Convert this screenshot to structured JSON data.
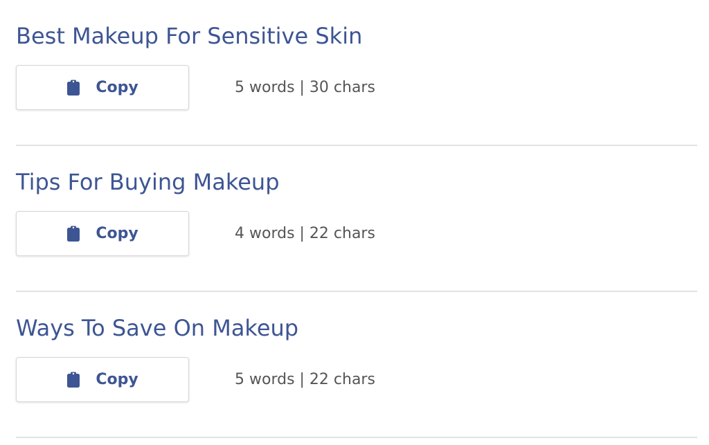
{
  "theme": {
    "accent": "#3d5593",
    "stats_color": "#555555",
    "divider_color": "#e2e2e2"
  },
  "entries": [
    {
      "title": "Best Makeup For Sensitive Skin",
      "copy_label": "Copy",
      "copy_icon": "clipboard-icon",
      "stats": "5 words | 30 chars"
    },
    {
      "title": "Tips For Buying Makeup",
      "copy_label": "Copy",
      "copy_icon": "clipboard-icon",
      "stats": "4 words | 22 chars"
    },
    {
      "title": "Ways To Save On Makeup",
      "copy_label": "Copy",
      "copy_icon": "clipboard-icon",
      "stats": "5 words | 22 chars"
    }
  ]
}
